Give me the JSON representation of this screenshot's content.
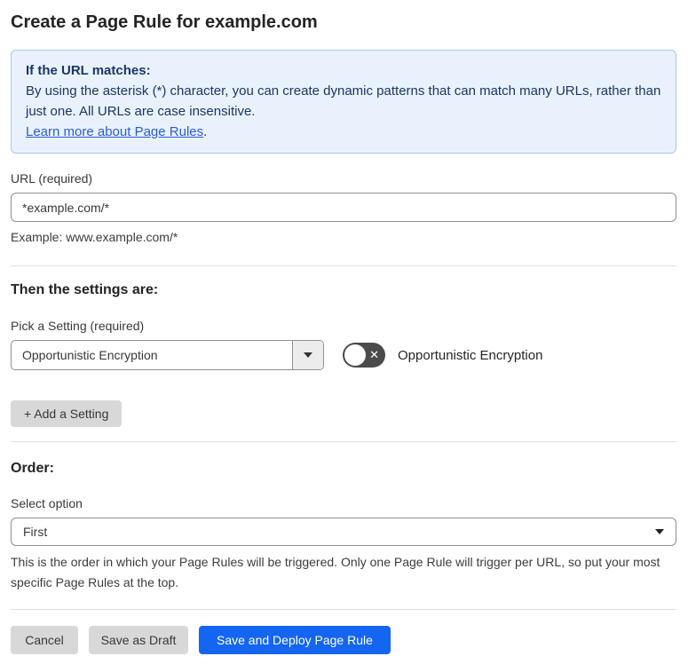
{
  "page": {
    "title": "Create a Page Rule for example.com"
  },
  "info_box": {
    "heading": "If the URL matches:",
    "body": "By using the asterisk (*) character, you can create dynamic patterns that can match many URLs, rather than just one. All URLs are case insensitive.",
    "link_label": "Learn more about Page Rules",
    "link_suffix": "."
  },
  "url_field": {
    "label": "URL (required)",
    "value": "*example.com/*",
    "example": "Example: www.example.com/*"
  },
  "settings_section": {
    "heading": "Then the settings are:",
    "pick_label": "Pick a Setting (required)",
    "selected_setting": "Opportunistic Encryption",
    "toggle_label": "Opportunistic Encryption",
    "toggle_state": "off",
    "toggle_x_glyph": "✕",
    "add_button_label": "+ Add a Setting"
  },
  "order_section": {
    "heading": "Order:",
    "select_label": "Select option",
    "selected_option": "First",
    "help_text": "This is the order in which your Page Rules will be triggered. Only one Page Rule will trigger per URL, so put your most specific Page Rules at the top."
  },
  "actions": {
    "cancel": "Cancel",
    "save_draft": "Save as Draft",
    "save_deploy": "Save and Deploy Page Rule"
  },
  "colors": {
    "primary_blue": "#1466f2",
    "info_bg": "#e9f2fc",
    "info_border": "#a6c8ec",
    "info_text": "#1b3666",
    "link_blue": "#2a5bd7",
    "toggle_bg": "#4b4b4b",
    "button_gray": "#d8d8d8"
  }
}
